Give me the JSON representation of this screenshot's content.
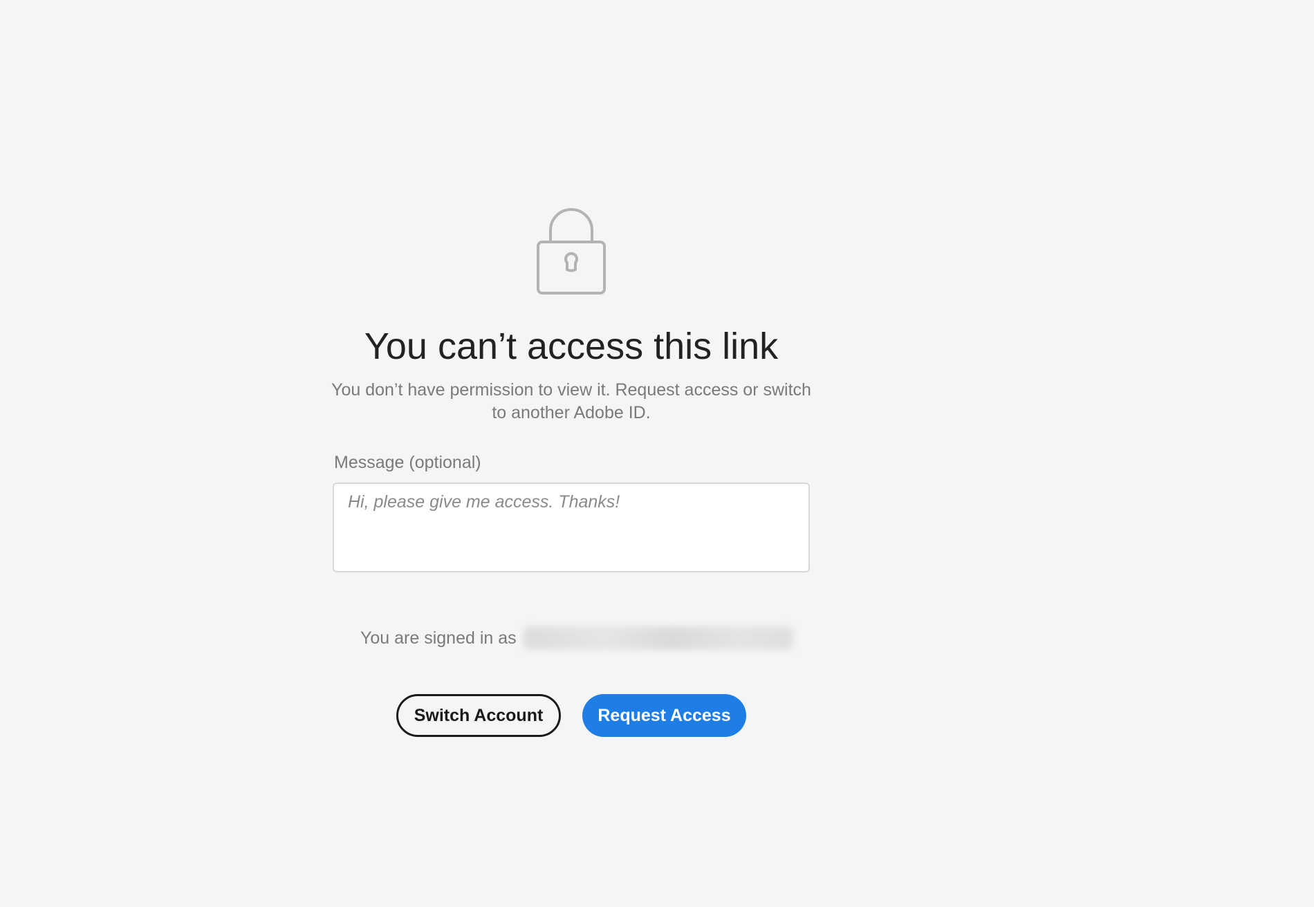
{
  "icons": {
    "lock": "lock-icon"
  },
  "colors": {
    "background": "#f5f5f5",
    "primary_button": "#1e7ee6",
    "title_text": "#222222",
    "secondary_text": "#7a7a7a"
  },
  "main": {
    "title": "You can’t access this link",
    "subtitle": "You don’t have permission to view it. Request access or switch to another Adobe ID.",
    "message_label": "Message (optional)",
    "message_placeholder": "Hi, please give me access. Thanks!",
    "signed_in_prefix": "You are signed in as"
  },
  "actions": {
    "switch_account_label": "Switch Account",
    "request_access_label": "Request Access"
  }
}
